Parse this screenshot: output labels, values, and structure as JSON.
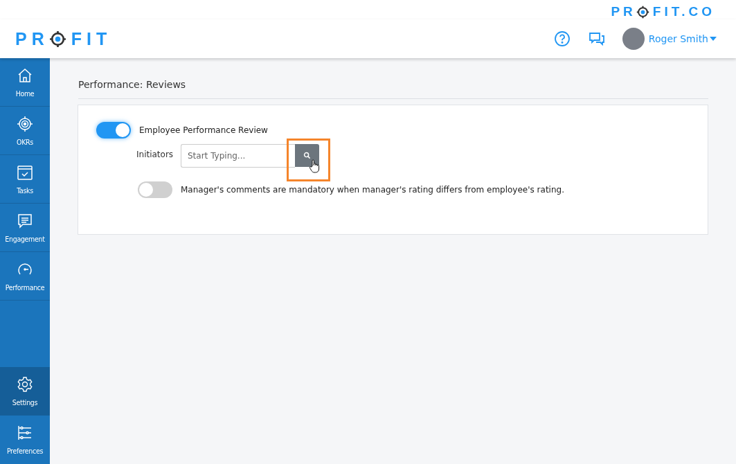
{
  "brand_banner": {
    "before": "PR",
    "after": "FIT.CO"
  },
  "header": {
    "logo": {
      "before": "PR",
      "after": "FIT"
    },
    "user": {
      "name": "Roger Smith"
    }
  },
  "sidebar": {
    "items": [
      {
        "kind": "home",
        "label": "Home",
        "selected": false
      },
      {
        "kind": "target",
        "label": "OKRs",
        "selected": false
      },
      {
        "kind": "tasks",
        "label": "Tasks",
        "selected": false
      },
      {
        "kind": "chat",
        "label": "Engagement",
        "selected": false
      },
      {
        "kind": "gauge",
        "label": "Performance",
        "selected": false
      }
    ],
    "bottom_items": [
      {
        "kind": "gear",
        "label": "Settings",
        "selected": true
      },
      {
        "kind": "sliders",
        "label": "Preferences",
        "selected": false
      }
    ]
  },
  "page": {
    "title": "Performance: Reviews",
    "settings": [
      {
        "kind": "toggle",
        "label": "Employee Performance Review",
        "on": true
      },
      {
        "kind": "field",
        "label": "Initiators",
        "placeholder": "Start Typing...",
        "highlighted": true
      },
      {
        "kind": "toggle",
        "label": "Manager's comments are mandatory when manager's rating differs from employee's rating.",
        "on": false
      }
    ]
  }
}
